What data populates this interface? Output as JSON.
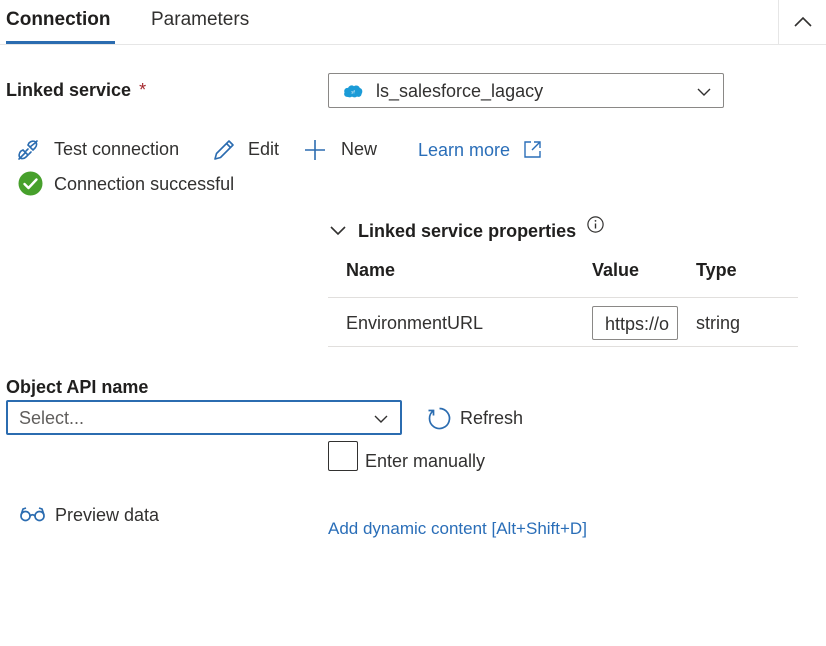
{
  "tabs": {
    "connection": "Connection",
    "parameters": "Parameters"
  },
  "linked_service": {
    "label": "Linked service",
    "required_marker": "*",
    "selected_value": "ls_salesforce_lagacy"
  },
  "actions": {
    "test_connection": "Test connection",
    "edit": "Edit",
    "new": "New",
    "learn_more": "Learn more"
  },
  "status": {
    "message": "Connection successful"
  },
  "properties": {
    "title": "Linked service properties",
    "columns": [
      "Name",
      "Value",
      "Type"
    ],
    "rows": [
      {
        "name": "EnvironmentURL",
        "value": "https://o",
        "type": "string"
      }
    ]
  },
  "object_api": {
    "label": "Object API name",
    "placeholder": "Select...",
    "refresh": "Refresh",
    "enter_manually": "Enter manually"
  },
  "preview": {
    "label": "Preview data"
  },
  "dynamic_content": {
    "label": "Add dynamic content [Alt+Shift+D]"
  },
  "colors": {
    "accent": "#2b6cb0",
    "link": "#2a6eb8",
    "success": "#47a02c",
    "required": "#a4262c",
    "salesforce": "#1b9bd7"
  }
}
